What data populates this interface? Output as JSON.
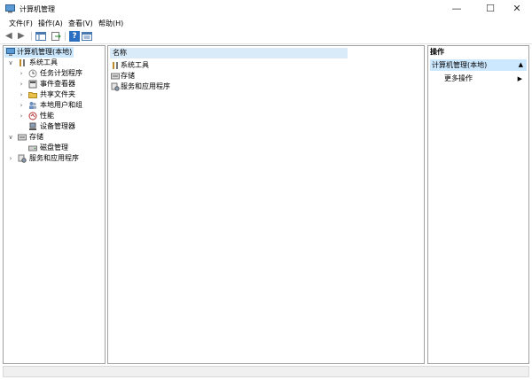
{
  "window": {
    "title": "计算机管理",
    "minimize": "—",
    "maximize": "☐",
    "close": "✕"
  },
  "menu": [
    "文件(F)",
    "操作(A)",
    "查看(V)",
    "帮助(H)"
  ],
  "toolbar": {
    "back": "◀",
    "forward": "▶",
    "help": "?",
    "icons": [
      "back-arrow-icon",
      "forward-arrow-icon",
      "console-tree-icon",
      "export-list-icon",
      "help-icon",
      "properties-icon"
    ]
  },
  "tree": {
    "root": "计算机管理(本地)",
    "items": [
      {
        "label": "系统工具",
        "chev": "∨",
        "icon": "tools-icon"
      },
      {
        "label": "任务计划程序",
        "chev": "›",
        "icon": "clock-icon"
      },
      {
        "label": "事件查看器",
        "chev": "›",
        "icon": "event-viewer-icon"
      },
      {
        "label": "共享文件夹",
        "chev": "›",
        "icon": "shared-folder-icon"
      },
      {
        "label": "本地用户和组",
        "chev": "›",
        "icon": "users-icon"
      },
      {
        "label": "性能",
        "chev": "›",
        "icon": "performance-icon"
      },
      {
        "label": "设备管理器",
        "chev": "",
        "icon": "device-manager-icon"
      },
      {
        "label": "存储",
        "chev": "∨",
        "icon": "storage-icon"
      },
      {
        "label": "磁盘管理",
        "chev": "",
        "icon": "disk-icon"
      },
      {
        "label": "服务和应用程序",
        "chev": "›",
        "icon": "services-icon"
      }
    ]
  },
  "list": {
    "column": "名称",
    "rows": [
      "系统工具",
      "存储",
      "服务和应用程序"
    ]
  },
  "actions": {
    "header": "操作",
    "section": "计算机管理(本地)",
    "section_toggle": "▲",
    "more": "更多操作",
    "more_arrow": "▶"
  },
  "colors": {
    "selection": "#cce8ff",
    "header": "#d9ebf9",
    "border": "#a0a0a0"
  }
}
